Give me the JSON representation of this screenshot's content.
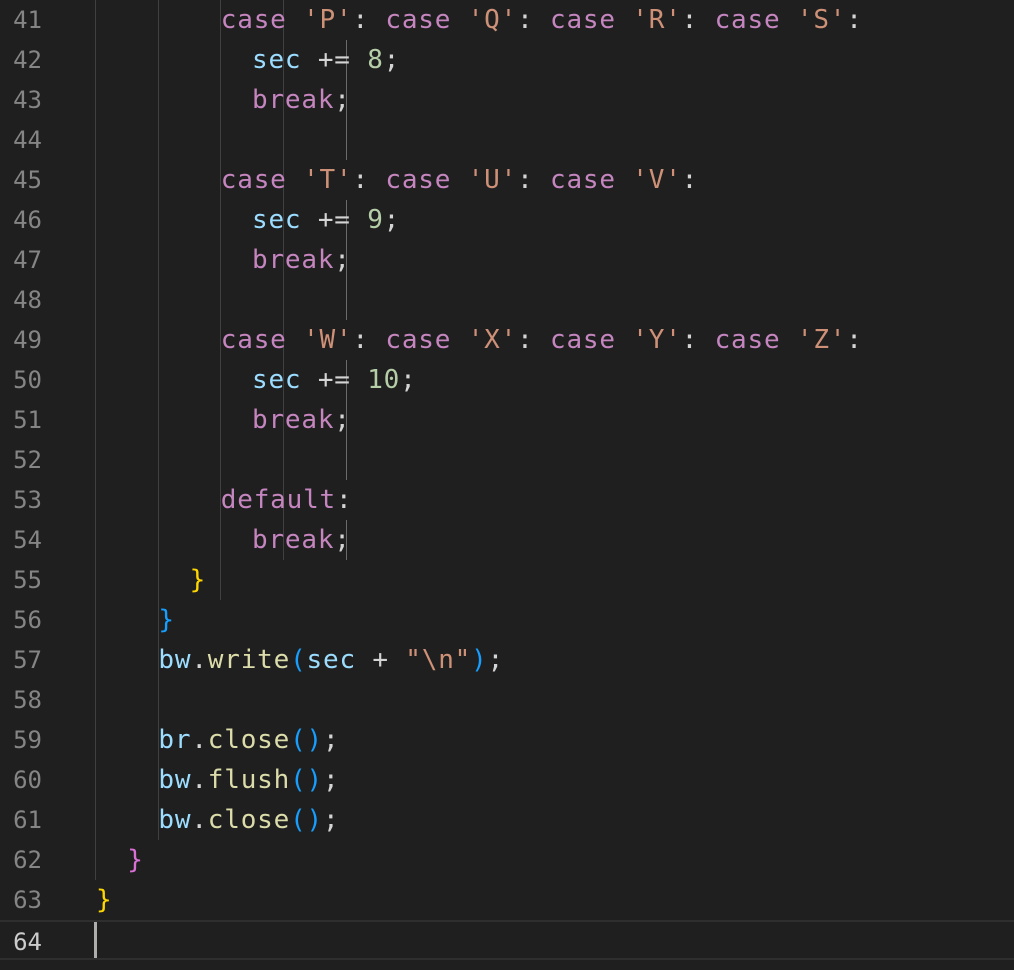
{
  "editor": {
    "theme_colors": {
      "background": "#1f1f1f",
      "keyword": "#c586c0",
      "string": "#ce9178",
      "variable": "#9cdcfe",
      "number": "#b5cea8",
      "function": "#dcdcaa",
      "bracket_gold": "#ffd700",
      "bracket_orchid": "#da70d6",
      "bracket_blue": "#179fff"
    },
    "current_line": "64",
    "lines": [
      {
        "number": "41",
        "indent": 8,
        "tokens": [
          [
            "kw",
            "case"
          ],
          [
            "op",
            " "
          ],
          [
            "str",
            "'P'"
          ],
          [
            "op",
            ": "
          ],
          [
            "kw",
            "case"
          ],
          [
            "op",
            " "
          ],
          [
            "str",
            "'Q'"
          ],
          [
            "op",
            ": "
          ],
          [
            "kw",
            "case"
          ],
          [
            "op",
            " "
          ],
          [
            "str",
            "'R'"
          ],
          [
            "op",
            ": "
          ],
          [
            "kw",
            "case"
          ],
          [
            "op",
            " "
          ],
          [
            "str",
            "'S'"
          ],
          [
            "op",
            ":"
          ]
        ]
      },
      {
        "number": "42",
        "indent": 10,
        "tokens": [
          [
            "var",
            "sec"
          ],
          [
            "op",
            " += "
          ],
          [
            "num",
            "8"
          ],
          [
            "op",
            ";"
          ]
        ]
      },
      {
        "number": "43",
        "indent": 10,
        "tokens": [
          [
            "kw",
            "break"
          ],
          [
            "op",
            ";"
          ]
        ]
      },
      {
        "number": "44",
        "indent": 0,
        "tokens": []
      },
      {
        "number": "45",
        "indent": 8,
        "tokens": [
          [
            "kw",
            "case"
          ],
          [
            "op",
            " "
          ],
          [
            "str",
            "'T'"
          ],
          [
            "op",
            ": "
          ],
          [
            "kw",
            "case"
          ],
          [
            "op",
            " "
          ],
          [
            "str",
            "'U'"
          ],
          [
            "op",
            ": "
          ],
          [
            "kw",
            "case"
          ],
          [
            "op",
            " "
          ],
          [
            "str",
            "'V'"
          ],
          [
            "op",
            ":"
          ]
        ]
      },
      {
        "number": "46",
        "indent": 10,
        "tokens": [
          [
            "var",
            "sec"
          ],
          [
            "op",
            " += "
          ],
          [
            "num",
            "9"
          ],
          [
            "op",
            ";"
          ]
        ]
      },
      {
        "number": "47",
        "indent": 10,
        "tokens": [
          [
            "kw",
            "break"
          ],
          [
            "op",
            ";"
          ]
        ]
      },
      {
        "number": "48",
        "indent": 0,
        "tokens": []
      },
      {
        "number": "49",
        "indent": 8,
        "tokens": [
          [
            "kw",
            "case"
          ],
          [
            "op",
            " "
          ],
          [
            "str",
            "'W'"
          ],
          [
            "op",
            ": "
          ],
          [
            "kw",
            "case"
          ],
          [
            "op",
            " "
          ],
          [
            "str",
            "'X'"
          ],
          [
            "op",
            ": "
          ],
          [
            "kw",
            "case"
          ],
          [
            "op",
            " "
          ],
          [
            "str",
            "'Y'"
          ],
          [
            "op",
            ": "
          ],
          [
            "kw",
            "case"
          ],
          [
            "op",
            " "
          ],
          [
            "str",
            "'Z'"
          ],
          [
            "op",
            ":"
          ]
        ]
      },
      {
        "number": "50",
        "indent": 10,
        "tokens": [
          [
            "var",
            "sec"
          ],
          [
            "op",
            " += "
          ],
          [
            "num",
            "10"
          ],
          [
            "op",
            ";"
          ]
        ]
      },
      {
        "number": "51",
        "indent": 10,
        "tokens": [
          [
            "kw",
            "break"
          ],
          [
            "op",
            ";"
          ]
        ]
      },
      {
        "number": "52",
        "indent": 0,
        "tokens": []
      },
      {
        "number": "53",
        "indent": 8,
        "tokens": [
          [
            "kw",
            "default"
          ],
          [
            "op",
            ":"
          ]
        ]
      },
      {
        "number": "54",
        "indent": 10,
        "tokens": [
          [
            "kw",
            "break"
          ],
          [
            "op",
            ";"
          ]
        ]
      },
      {
        "number": "55",
        "indent": 6,
        "tokens": [
          [
            "b1",
            "}"
          ]
        ]
      },
      {
        "number": "56",
        "indent": 4,
        "tokens": [
          [
            "b3",
            "}"
          ]
        ]
      },
      {
        "number": "57",
        "indent": 4,
        "tokens": [
          [
            "var",
            "bw"
          ],
          [
            "op",
            "."
          ],
          [
            "fn",
            "write"
          ],
          [
            "b3",
            "("
          ],
          [
            "var",
            "sec"
          ],
          [
            "op",
            " + "
          ],
          [
            "str",
            "\"\\n\""
          ],
          [
            "b3",
            ")"
          ],
          [
            "op",
            ";"
          ]
        ]
      },
      {
        "number": "58",
        "indent": 0,
        "tokens": []
      },
      {
        "number": "59",
        "indent": 4,
        "tokens": [
          [
            "var",
            "br"
          ],
          [
            "op",
            "."
          ],
          [
            "fn",
            "close"
          ],
          [
            "b3",
            "()"
          ],
          [
            "op",
            ";"
          ]
        ]
      },
      {
        "number": "60",
        "indent": 4,
        "tokens": [
          [
            "var",
            "bw"
          ],
          [
            "op",
            "."
          ],
          [
            "fn",
            "flush"
          ],
          [
            "b3",
            "()"
          ],
          [
            "op",
            ";"
          ]
        ]
      },
      {
        "number": "61",
        "indent": 4,
        "tokens": [
          [
            "var",
            "bw"
          ],
          [
            "op",
            "."
          ],
          [
            "fn",
            "close"
          ],
          [
            "b3",
            "()"
          ],
          [
            "op",
            ";"
          ]
        ]
      },
      {
        "number": "62",
        "indent": 2,
        "tokens": [
          [
            "b2",
            "}"
          ]
        ]
      },
      {
        "number": "63",
        "indent": 0,
        "tokens": [
          [
            "b1",
            "}"
          ]
        ]
      },
      {
        "number": "64",
        "indent": 0,
        "tokens": []
      }
    ]
  }
}
